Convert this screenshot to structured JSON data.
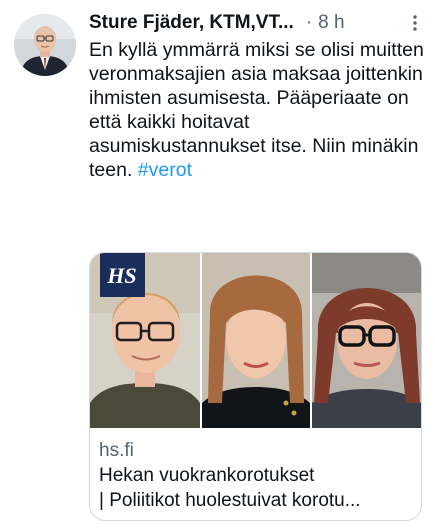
{
  "tweet": {
    "author_name": "Sture Fjäder, KTM,VT...",
    "separator": "·",
    "time": "8 h",
    "text": "En kyllä ymmärrä miksi se olisi muitten veronmaksajien asia maksaa joittenkin ihmisten asumisesta. Pääperiaate on että kaikki hoitavat asumiskustannukset itse. Niin minäkin teen. ",
    "hashtag": "#verot"
  },
  "card": {
    "logo_text": "HS",
    "domain": "hs.fi",
    "title_line1": "Hekan vuokrankorotukset",
    "title_line2": "| Poliitikot huolestuivat korotu..."
  },
  "icons": {
    "more": "more-vertical-icon",
    "avatar": "profile-avatar"
  },
  "colors": {
    "text": "#0f1419",
    "secondary": "#536471",
    "link": "#1d9bf0",
    "hs_logo_bg": "#1b2d5a"
  }
}
